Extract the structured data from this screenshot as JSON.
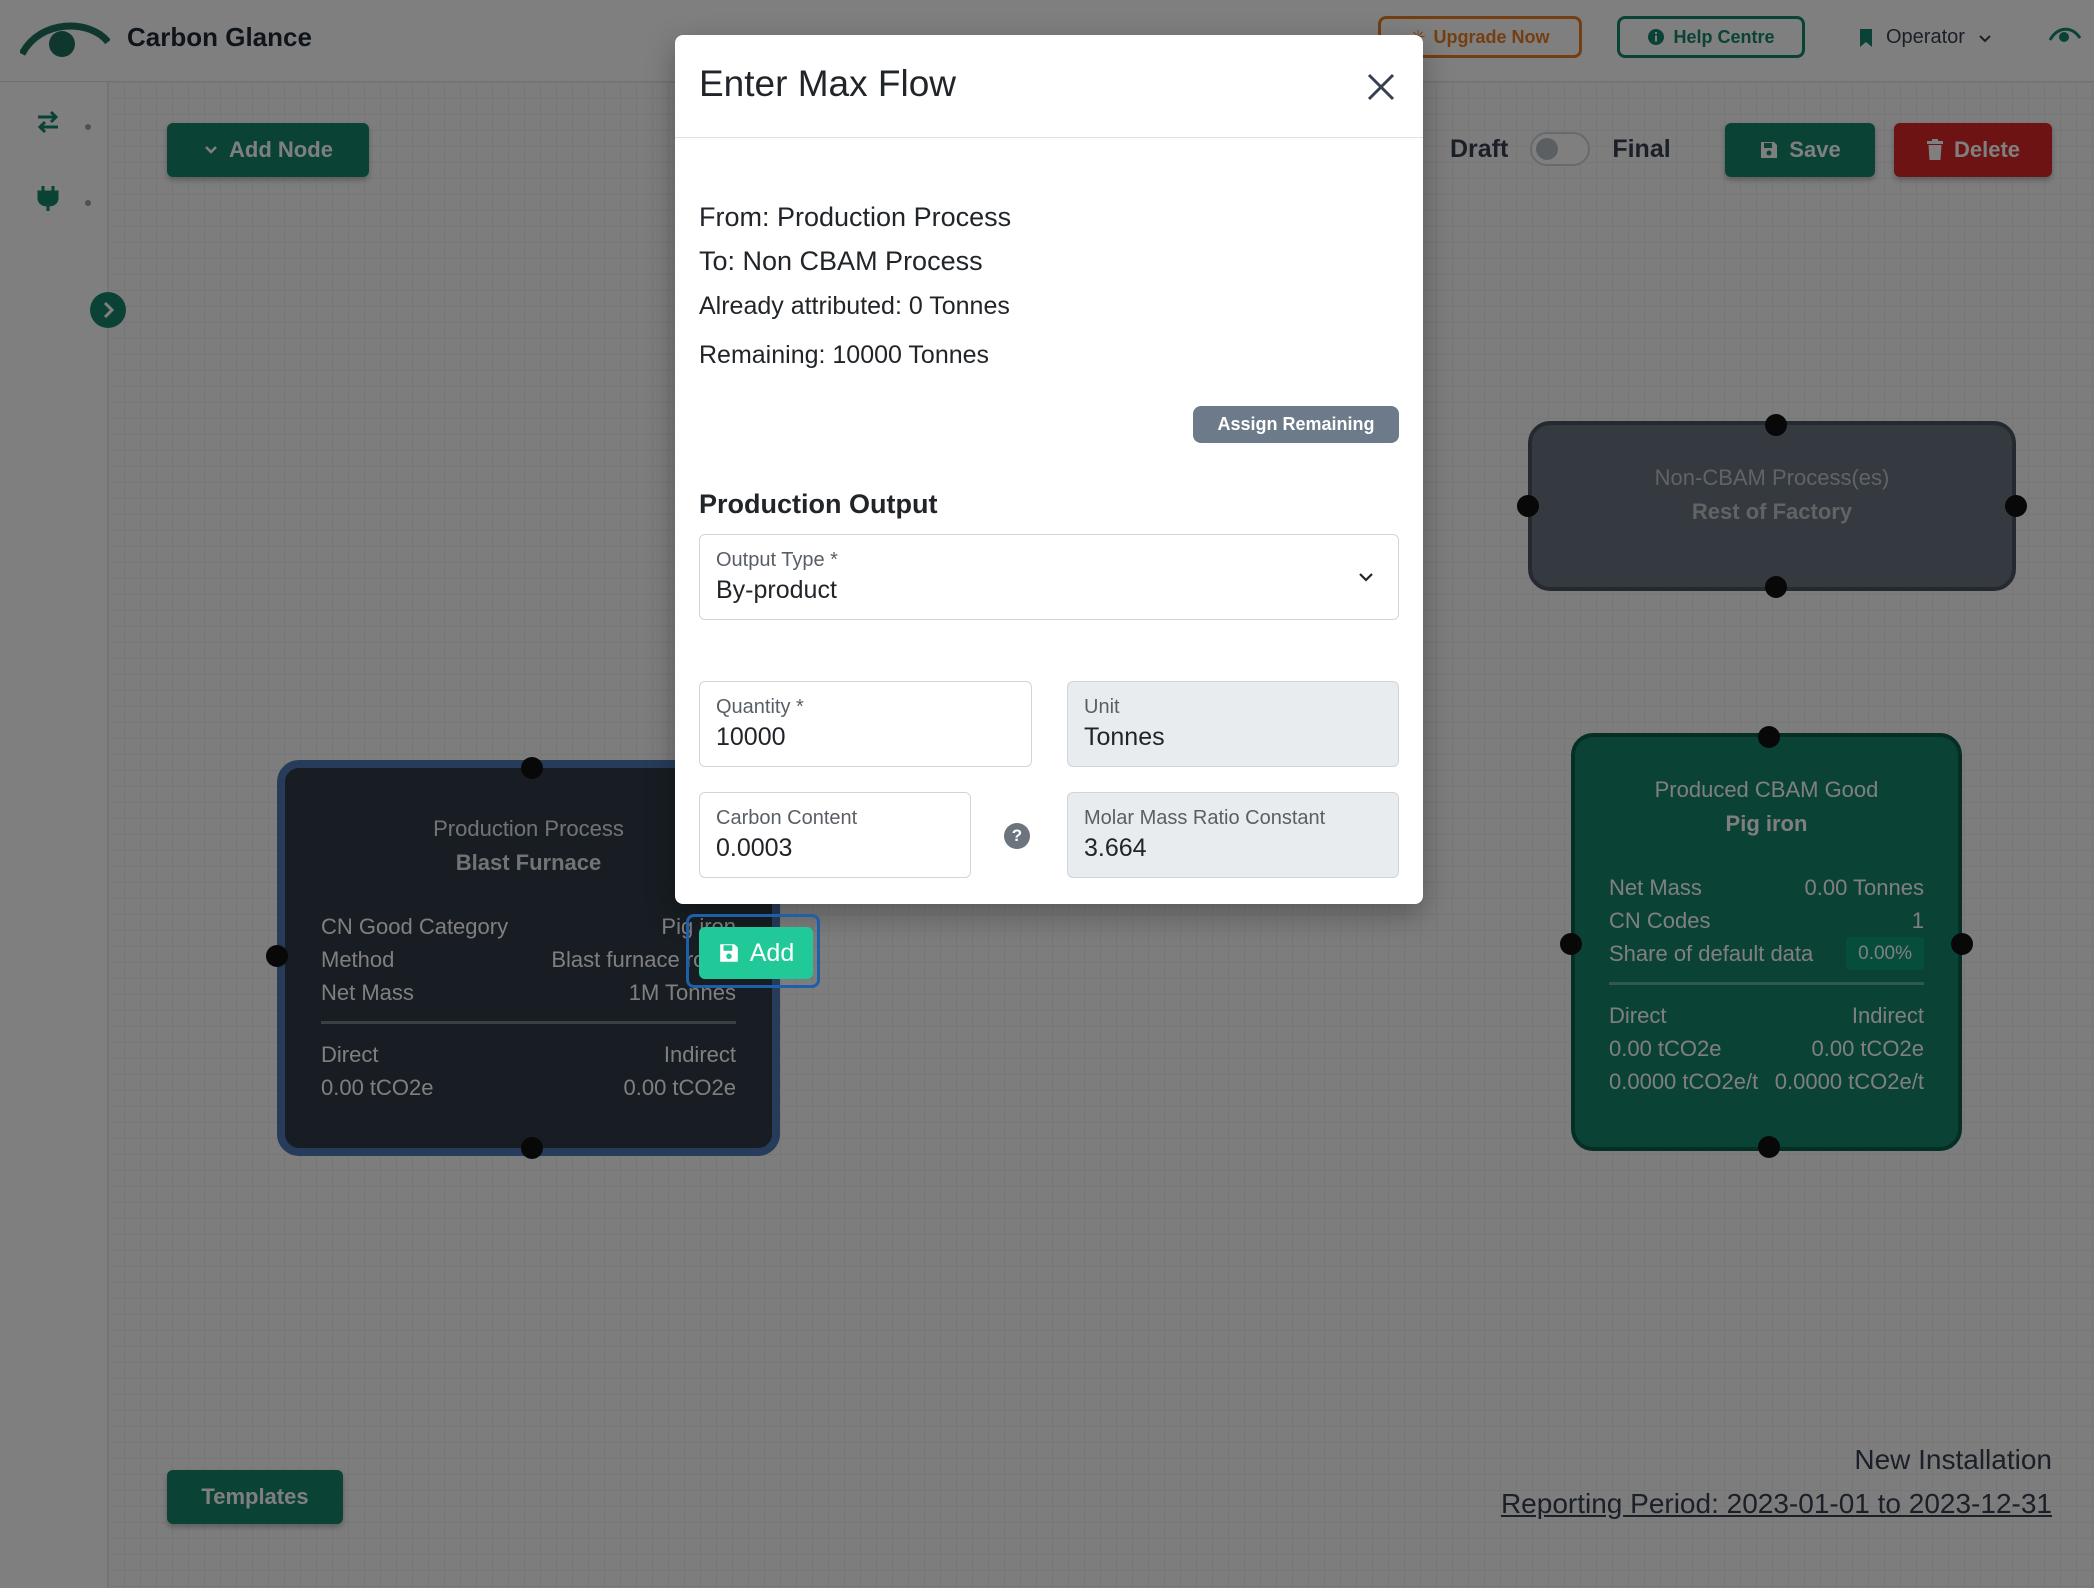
{
  "header": {
    "app_title": "Carbon Glance",
    "upgrade_label": "Upgrade Now",
    "help_label": "Help Centre",
    "user_label": "Operator"
  },
  "toolbar": {
    "add_node_label": "Add Node",
    "draft_label": "Draft",
    "final_label": "Final",
    "save_label": "Save",
    "delete_label": "Delete",
    "templates_label": "Templates"
  },
  "footer": {
    "installation": "New Installation",
    "reporting_period": "Reporting Period: 2023-01-01 to 2023-12-31"
  },
  "nodes": {
    "production": {
      "title": "Production Process",
      "subtitle": "Blast Furnace",
      "rows": [
        {
          "key": "CN Good Category",
          "value": "Pig iron"
        },
        {
          "key": "Method",
          "value": "Blast furnace route"
        },
        {
          "key": "Net Mass",
          "value": "1M Tonnes"
        }
      ],
      "direct_label": "Direct",
      "indirect_label": "Indirect",
      "direct_value": "0.00 tCO2e",
      "indirect_value": "0.00 tCO2e"
    },
    "noncbam": {
      "title": "Non-CBAM Process(es)",
      "subtitle": "Rest of Factory"
    },
    "cbam": {
      "title": "Produced CBAM Good",
      "subtitle": "Pig iron",
      "net_mass_label": "Net Mass",
      "net_mass_value": "0.00 Tonnes",
      "cn_codes_label": "CN Codes",
      "cn_codes_value": "1",
      "share_label": "Share of default data",
      "share_value": "0.00%",
      "direct_label": "Direct",
      "indirect_label": "Indirect",
      "direct_value": "0.00 tCO2e",
      "indirect_value": "0.00 tCO2e",
      "direct_intensity": "0.0000 tCO2e/t",
      "indirect_intensity": "0.0000 tCO2e/t"
    }
  },
  "modal": {
    "title": "Enter Max Flow",
    "from": "From: Production Process",
    "to": "To: Non CBAM Process",
    "already": "Already attributed: 0 Tonnes",
    "remaining": "Remaining: 10000 Tonnes",
    "assign_label": "Assign Remaining",
    "section_title": "Production Output",
    "output_type_label": "Output Type *",
    "output_type_value": "By-product",
    "quantity_label": "Quantity *",
    "quantity_value": "10000",
    "unit_label": "Unit",
    "unit_value": "Tonnes",
    "carbon_label": "Carbon Content",
    "carbon_value": "0.0003",
    "molar_label": "Molar Mass Ratio Constant",
    "molar_value": "3.664",
    "add_label": "Add"
  },
  "colors": {
    "brand_green": "#14866d",
    "accent_teal": "#20c997",
    "danger_red": "#dc2626",
    "upgrade_orange": "#e67e22"
  }
}
